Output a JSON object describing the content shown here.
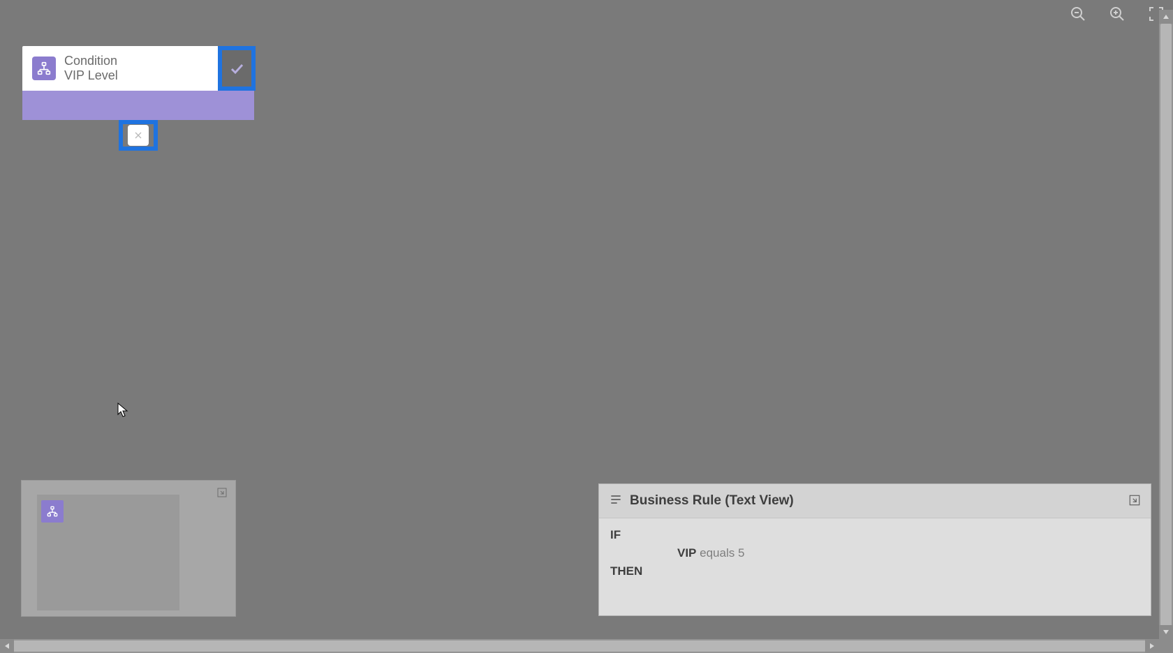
{
  "toolbar": {
    "zoom_out": "zoom-out",
    "zoom_in": "zoom-in",
    "fit": "fit-to-screen"
  },
  "condition_node": {
    "type_label": "Condition",
    "name": "VIP Level",
    "true_branch": "true",
    "false_branch": "false"
  },
  "minimap": {
    "expand": "expand"
  },
  "textview": {
    "title": "Business Rule (Text View)",
    "if_label": "IF",
    "then_label": "THEN",
    "expression": {
      "field": "VIP",
      "operator": "equals",
      "value": "5"
    },
    "expand": "expand"
  }
}
